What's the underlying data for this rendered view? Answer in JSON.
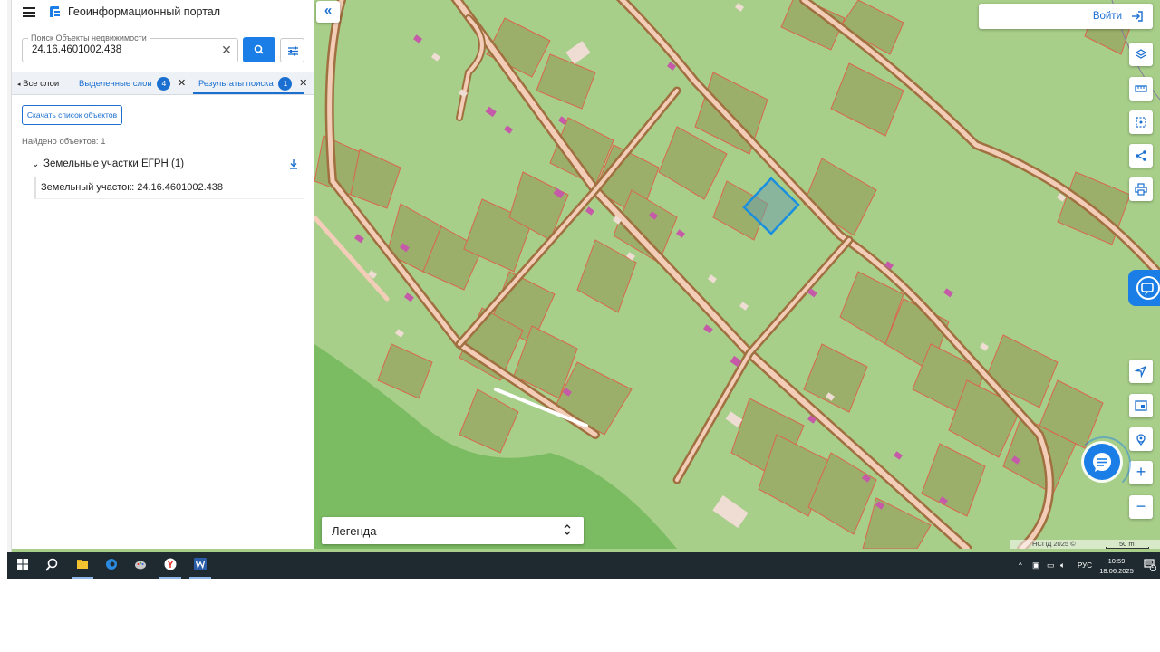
{
  "header": {
    "title": "Геоинформационный портал"
  },
  "search": {
    "label": "Поиск Объекты недвижимости",
    "value": "24.16.4601002.438"
  },
  "tabs": [
    {
      "label": "Все слои"
    },
    {
      "label": "Выделенные слои",
      "count": "4"
    },
    {
      "label": "Результаты поиска",
      "count": "1"
    }
  ],
  "results": {
    "download_label": "Скачать список объектов",
    "found_text": "Найдено объектов: 1",
    "group_title": "Земельные участки ЕГРН (1)",
    "item_text": "Земельный участок: 24.16.4601002.438"
  },
  "map": {
    "login_label": "Войти",
    "legend_label": "Легенда",
    "attribution": "НСПД 2025 ©",
    "scale_label": "50 m",
    "zoom_in": "+",
    "zoom_out": "−",
    "collapse_symbol": "«",
    "colors": {
      "base": "#a8cf8a",
      "parcel_fill": "#9caf6a",
      "parcel_border": "#d9664e",
      "road": "#f3cdb8",
      "road_edge": "#a07040",
      "forest": "#7bbb62",
      "building": "#c45aa8",
      "selected_parcel": "#1a8fe0",
      "accent": "#1a7ee6"
    }
  },
  "taskbar": {
    "language": "РУС",
    "time": "10:59",
    "date": "18.06.2025",
    "notification_count": "1"
  }
}
